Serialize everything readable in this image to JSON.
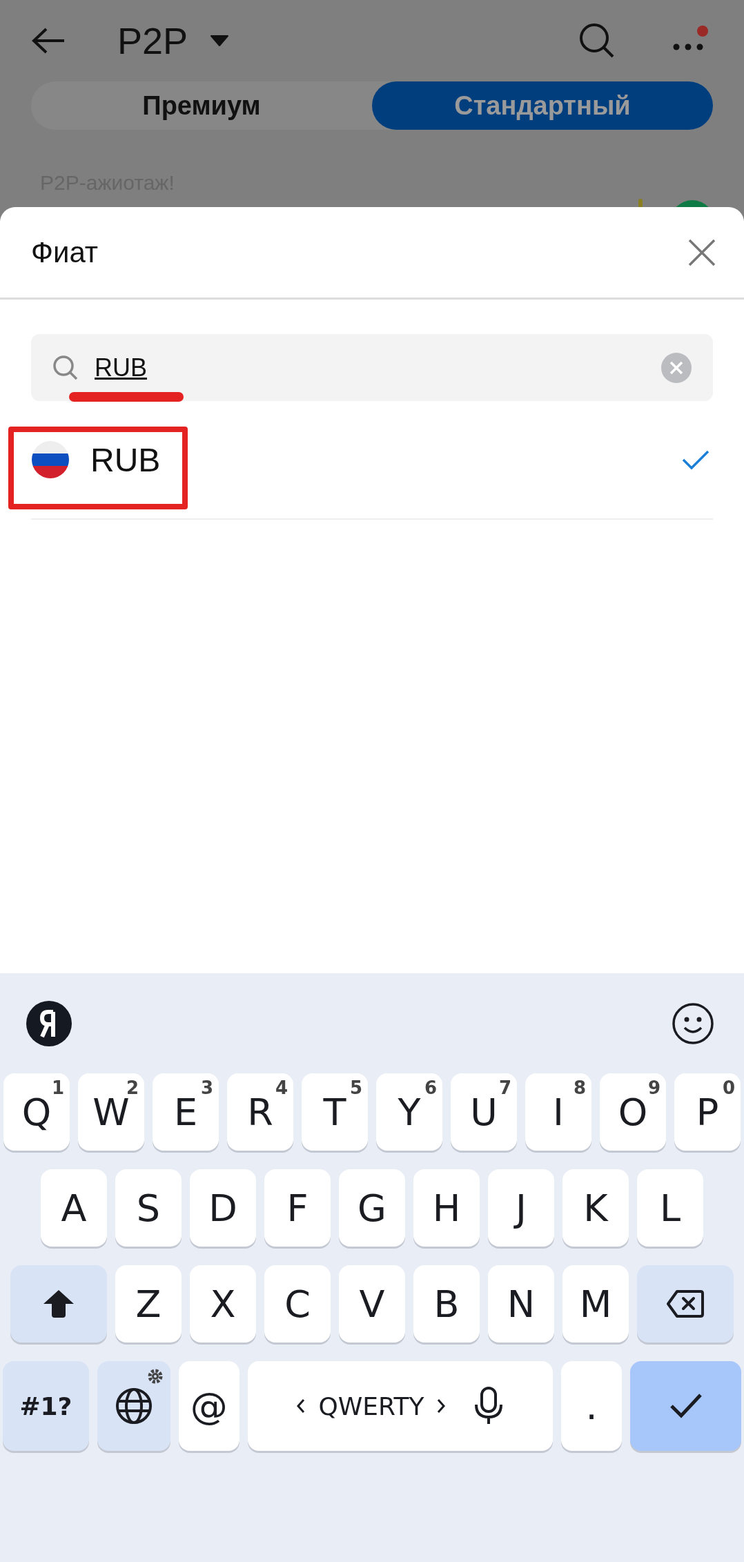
{
  "header": {
    "title": "P2P"
  },
  "tabs": [
    {
      "label": "Премиум",
      "selected": false
    },
    {
      "label": "Стандартный",
      "selected": true
    }
  ],
  "banner": {
    "text": "P2P-ажиотаж!"
  },
  "sheet": {
    "title": "Фиат",
    "search": {
      "value": "RUB"
    },
    "results": [
      {
        "label": "RUB",
        "selected": true
      }
    ]
  },
  "annotations": [
    {
      "kind": "underline"
    },
    {
      "kind": "box"
    }
  ],
  "keyboard": {
    "rows": [
      [
        {
          "kind": "letter",
          "label": "Q",
          "hint": "1"
        },
        {
          "kind": "letter",
          "label": "W",
          "hint": "2"
        },
        {
          "kind": "letter",
          "label": "E",
          "hint": "3"
        },
        {
          "kind": "letter",
          "label": "R",
          "hint": "4"
        },
        {
          "kind": "letter",
          "label": "T",
          "hint": "5"
        },
        {
          "kind": "letter",
          "label": "Y",
          "hint": "6"
        },
        {
          "kind": "letter",
          "label": "U",
          "hint": "7"
        },
        {
          "kind": "letter",
          "label": "I",
          "hint": "8"
        },
        {
          "kind": "letter",
          "label": "O",
          "hint": "9"
        },
        {
          "kind": "letter",
          "label": "P",
          "hint": "0"
        }
      ],
      [
        {
          "kind": "letter",
          "label": "A"
        },
        {
          "kind": "letter",
          "label": "S"
        },
        {
          "kind": "letter",
          "label": "D"
        },
        {
          "kind": "letter",
          "label": "F"
        },
        {
          "kind": "letter",
          "label": "G"
        },
        {
          "kind": "letter",
          "label": "H"
        },
        {
          "kind": "letter",
          "label": "J"
        },
        {
          "kind": "letter",
          "label": "K"
        },
        {
          "kind": "letter",
          "label": "L"
        }
      ],
      [
        {
          "kind": "shift"
        },
        {
          "kind": "letter",
          "label": "Z"
        },
        {
          "kind": "letter",
          "label": "X"
        },
        {
          "kind": "letter",
          "label": "C"
        },
        {
          "kind": "letter",
          "label": "V"
        },
        {
          "kind": "letter",
          "label": "B"
        },
        {
          "kind": "letter",
          "label": "N"
        },
        {
          "kind": "letter",
          "label": "M"
        },
        {
          "kind": "backspace"
        }
      ]
    ],
    "bottom_row": [
      {
        "kind": "symbols",
        "label": "#1?"
      },
      {
        "kind": "globe"
      },
      {
        "kind": "char",
        "label": "@"
      },
      {
        "kind": "space",
        "label": "QWERTY"
      },
      {
        "kind": "char",
        "label": "."
      },
      {
        "kind": "enter"
      }
    ]
  }
}
